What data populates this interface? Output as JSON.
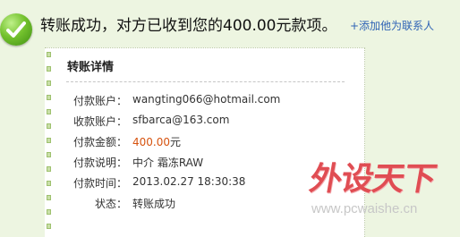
{
  "banner": {
    "icon": "check-icon",
    "message": "转账成功，对方已收到您的400.00元款项。",
    "add_contact_link": "+添加他为联系人"
  },
  "details": {
    "title": "转账详情",
    "rows": [
      {
        "label": "付款账户：",
        "value": "wangting066@hotmail.com"
      },
      {
        "label": "收款账户：",
        "value": "sfbarca@163.com"
      },
      {
        "label": "付款金额：",
        "amount": "400.00",
        "unit": "元"
      },
      {
        "label": "付款说明：",
        "value": "中介 霜冻RAW"
      },
      {
        "label": "付款时间：",
        "value": "2013.02.27 18:30:38"
      },
      {
        "label": "状态：",
        "value": "转账成功"
      }
    ]
  },
  "watermark": {
    "logo_text": "外设天下",
    "url": "www.pcwaishe.cn"
  },
  "colors": {
    "background": "#edf5e1",
    "link": "#2f63b5",
    "amount": "#d6530f",
    "success_green": "#5aab1f",
    "watermark_red": "#e04d53"
  }
}
